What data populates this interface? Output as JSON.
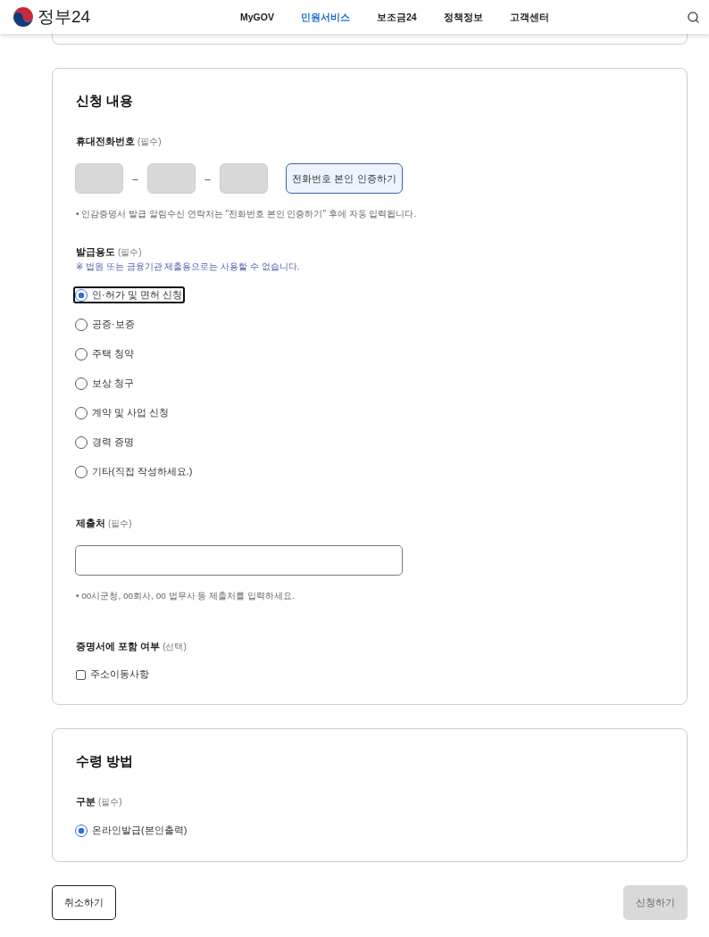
{
  "header": {
    "logo": "정부24",
    "nav": [
      {
        "label": "MyGOV",
        "selected": false
      },
      {
        "label": "민원서비스",
        "selected": true
      },
      {
        "label": "보조금24",
        "selected": false
      },
      {
        "label": "정책정보",
        "selected": false
      },
      {
        "label": "고객센터",
        "selected": false
      }
    ]
  },
  "sections": [
    {
      "title": "신청 내용",
      "fields": [
        {
          "kind": "phone",
          "label": "휴대전화번호",
          "requirement": "(필수)",
          "separators": [
            "–",
            "–"
          ],
          "button": "전화번호 본인 인증하기",
          "note": "• 인감증명서 발급 알림수신 연락처는 \"전화번호 본인 인증하기\" 후에 자동 입력됩니다."
        },
        {
          "kind": "radio",
          "label": "발급용도",
          "requirement": "(필수)",
          "notice": "※ 법원 또는 금융기관 제출용으로는 사용할 수 없습니다.",
          "options": [
            {
              "label": "인·허가 및 면허 신청",
              "selected": true,
              "focused": true
            },
            {
              "label": "공증·보증",
              "selected": false,
              "focused": false
            },
            {
              "label": "주택 청약",
              "selected": false,
              "focused": false
            },
            {
              "label": "보상 청구",
              "selected": false,
              "focused": false
            },
            {
              "label": "계약 및 사업 신청",
              "selected": false,
              "focused": false
            },
            {
              "label": "경력 증명",
              "selected": false,
              "focused": false
            },
            {
              "label": "기타(직접 작성하세요.)",
              "selected": false,
              "focused": false
            }
          ]
        },
        {
          "kind": "text",
          "label": "제출처",
          "requirement": "(필수)",
          "note": "• oo시군청, oo회사, oo 법무사 등 제출처를 입력하세요."
        },
        {
          "kind": "checkbox",
          "label": "증명서에 포함 여부",
          "requirement": "(선택)",
          "options": [
            {
              "label": "주소이동사항",
              "checked": false
            }
          ]
        }
      ]
    },
    {
      "title": "수령 방법",
      "fields": [
        {
          "kind": "radio",
          "label": "구분",
          "requirement": "(필수)",
          "options": [
            {
              "label": "온라인발급(본인출력)",
              "selected": true,
              "focused": false
            }
          ]
        }
      ]
    }
  ],
  "actions": [
    {
      "label": "취소하기",
      "disabled": false
    },
    {
      "label": "신청하기",
      "disabled": true
    }
  ]
}
